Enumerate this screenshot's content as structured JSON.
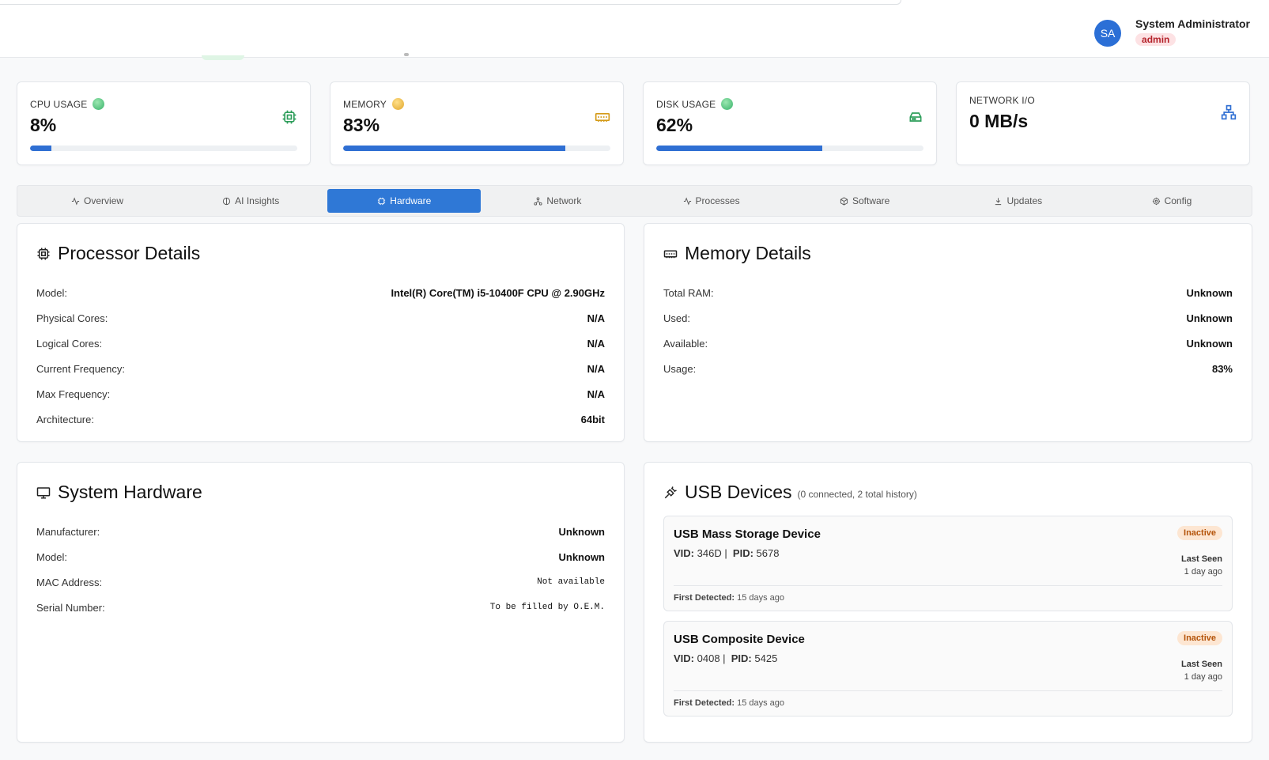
{
  "header": {
    "user_initials": "SA",
    "user_name": "System Administrator",
    "user_role": "admin"
  },
  "stats": [
    {
      "label": "CPU USAGE",
      "value": "8%",
      "percent": 8,
      "status": "green",
      "icon": "cpu-icon",
      "icon_color": "#2e9e5b"
    },
    {
      "label": "MEMORY",
      "value": "83%",
      "percent": 83,
      "status": "amber",
      "icon": "memory-icon",
      "icon_color": "#d49a17"
    },
    {
      "label": "DISK USAGE",
      "value": "62%",
      "percent": 62,
      "status": "green",
      "icon": "disk-icon",
      "icon_color": "#2e9e5b"
    },
    {
      "label": "NETWORK I/O",
      "value": "0 MB/s",
      "percent": null,
      "status": "none",
      "icon": "network-icon",
      "icon_color": "#2f6fd3"
    }
  ],
  "tabs": [
    {
      "label": "Overview",
      "icon": "activity-icon"
    },
    {
      "label": "AI Insights",
      "icon": "brain-icon"
    },
    {
      "label": "Hardware",
      "icon": "cpu-icon",
      "active": true
    },
    {
      "label": "Network",
      "icon": "network-icon"
    },
    {
      "label": "Processes",
      "icon": "activity-icon"
    },
    {
      "label": "Software",
      "icon": "package-icon"
    },
    {
      "label": "Updates",
      "icon": "download-icon"
    },
    {
      "label": "Config",
      "icon": "gear-icon"
    }
  ],
  "processor": {
    "title": "Processor Details",
    "rows": [
      {
        "k": "Model:",
        "v": "Intel(R) Core(TM) i5-10400F CPU @ 2.90GHz"
      },
      {
        "k": "Physical Cores:",
        "v": "N/A"
      },
      {
        "k": "Logical Cores:",
        "v": "N/A"
      },
      {
        "k": "Current Frequency:",
        "v": "N/A"
      },
      {
        "k": "Max Frequency:",
        "v": "N/A"
      },
      {
        "k": "Architecture:",
        "v": "64bit"
      }
    ]
  },
  "memory": {
    "title": "Memory Details",
    "rows": [
      {
        "k": "Total RAM:",
        "v": "Unknown"
      },
      {
        "k": "Used:",
        "v": "Unknown"
      },
      {
        "k": "Available:",
        "v": "Unknown"
      },
      {
        "k": "Usage:",
        "v": "83%"
      }
    ]
  },
  "system": {
    "title": "System Hardware",
    "rows": [
      {
        "k": "Manufacturer:",
        "v": "Unknown",
        "mono": false
      },
      {
        "k": "Model:",
        "v": "Unknown",
        "mono": false
      },
      {
        "k": "MAC Address:",
        "v": "Not available",
        "mono": true
      },
      {
        "k": "Serial Number:",
        "v": "To be filled by O.E.M.",
        "mono": true
      }
    ]
  },
  "usb": {
    "title": "USB Devices",
    "subtitle": "(0 connected, 2 total history)",
    "vid_label": "VID:",
    "pid_label": "PID:",
    "last_seen_label": "Last Seen",
    "first_detected_label": "First Detected:",
    "devices": [
      {
        "name": "USB Mass Storage Device",
        "vid": "346D",
        "pid": "5678",
        "status": "Inactive",
        "last_seen": "1 day ago",
        "first_detected": "15 days ago"
      },
      {
        "name": "USB Composite Device",
        "vid": "0408",
        "pid": "5425",
        "status": "Inactive",
        "last_seen": "1 day ago",
        "first_detected": "15 days ago"
      }
    ]
  }
}
